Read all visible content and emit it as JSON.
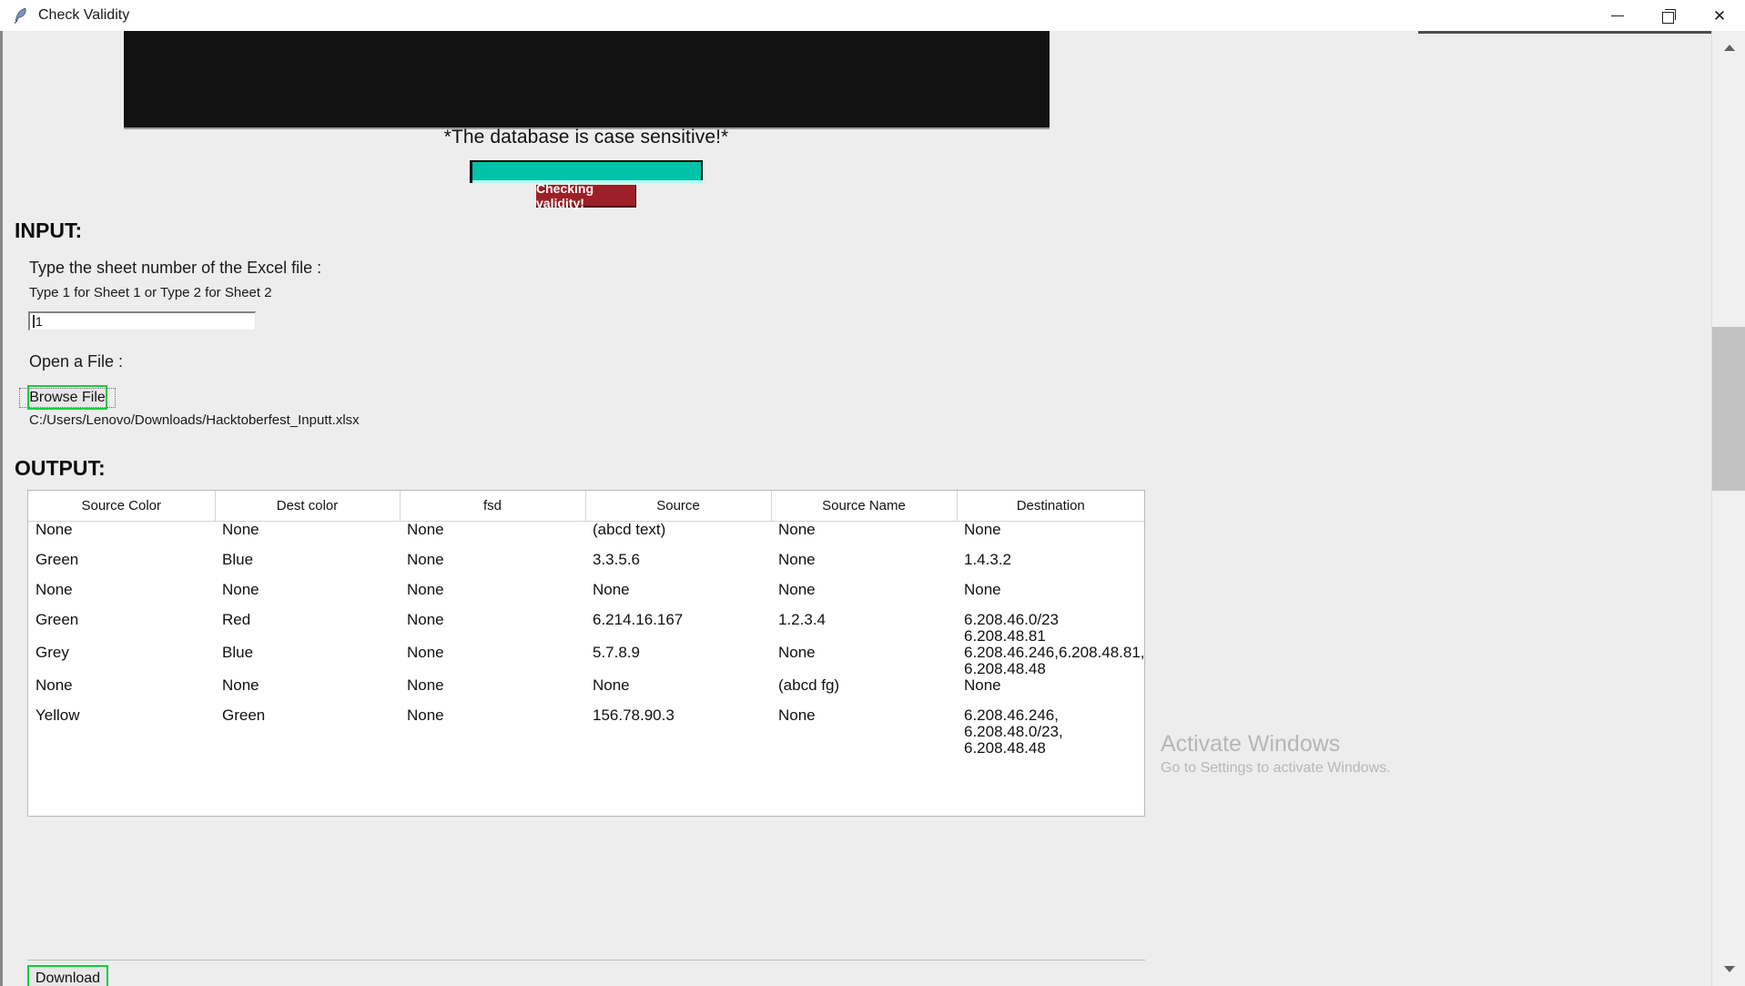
{
  "window": {
    "title": "Check Validity",
    "icon": "feather-icon",
    "controls": {
      "minimize": "—",
      "maximize": "❐",
      "close": "✕"
    }
  },
  "banner": {
    "note": "*The database is case sensitive!*"
  },
  "status": {
    "progress_label": "Checking validity!",
    "progress_percent": 100,
    "progress_color": "#00c2a8",
    "badge_color": "#9c2028"
  },
  "input": {
    "heading": "INPUT:",
    "sheet_label": "Type the sheet number of the Excel file :",
    "sheet_hint": "Type 1 for Sheet 1 or Type 2 for Sheet 2",
    "sheet_value": "1",
    "sheet_placeholder": "",
    "open_label": "Open a File :",
    "browse_button": "Browse File",
    "file_path": "C:/Users/Lenovo/Downloads/Hacktoberfest_Inputt.xlsx"
  },
  "output": {
    "heading": "OUTPUT:",
    "download_button": "Download",
    "columns": [
      "Source Color",
      "Dest color",
      "fsd",
      "Source",
      "Source Name",
      "Destination"
    ],
    "rows": [
      {
        "source_color": "None",
        "dest_color": "None",
        "fsd": "None",
        "source": "(abcd text)",
        "source_name": "None",
        "destination": [
          "None"
        ]
      },
      {
        "source_color": "Green",
        "dest_color": "Blue",
        "fsd": "None",
        "source": "3.3.5.6",
        "source_name": "None",
        "destination": [
          "1.4.3.2"
        ]
      },
      {
        "source_color": "None",
        "dest_color": "None",
        "fsd": "None",
        "source": "None",
        "source_name": "None",
        "destination": [
          "None"
        ]
      },
      {
        "source_color": "Green",
        "dest_color": "Red",
        "fsd": "None",
        "source": "6.214.16.167",
        "source_name": "1.2.3.4",
        "destination": [
          "6.208.46.0/23",
          "6.208.48.81"
        ]
      },
      {
        "source_color": "Grey",
        "dest_color": "Blue",
        "fsd": "None",
        "source": "5.7.8.9",
        "source_name": "None",
        "destination": [
          "6.208.46.246,6.208.48.81,",
          "6.208.48.48"
        ]
      },
      {
        "source_color": "None",
        "dest_color": "None",
        "fsd": "None",
        "source": "None",
        "source_name": "(abcd fg)",
        "destination": [
          "None"
        ]
      },
      {
        "source_color": "Yellow",
        "dest_color": "Green",
        "fsd": "None",
        "source": "156.78.90.3",
        "source_name": "None",
        "destination": [
          "6.208.46.246,",
          "6.208.48.0/23,",
          "6.208.48.48"
        ]
      }
    ]
  },
  "watermark": {
    "title": "Activate Windows",
    "subtitle": "Go to Settings to activate Windows."
  },
  "scrollbar": {
    "up_arrow": "▲",
    "down_arrow": "▼"
  }
}
